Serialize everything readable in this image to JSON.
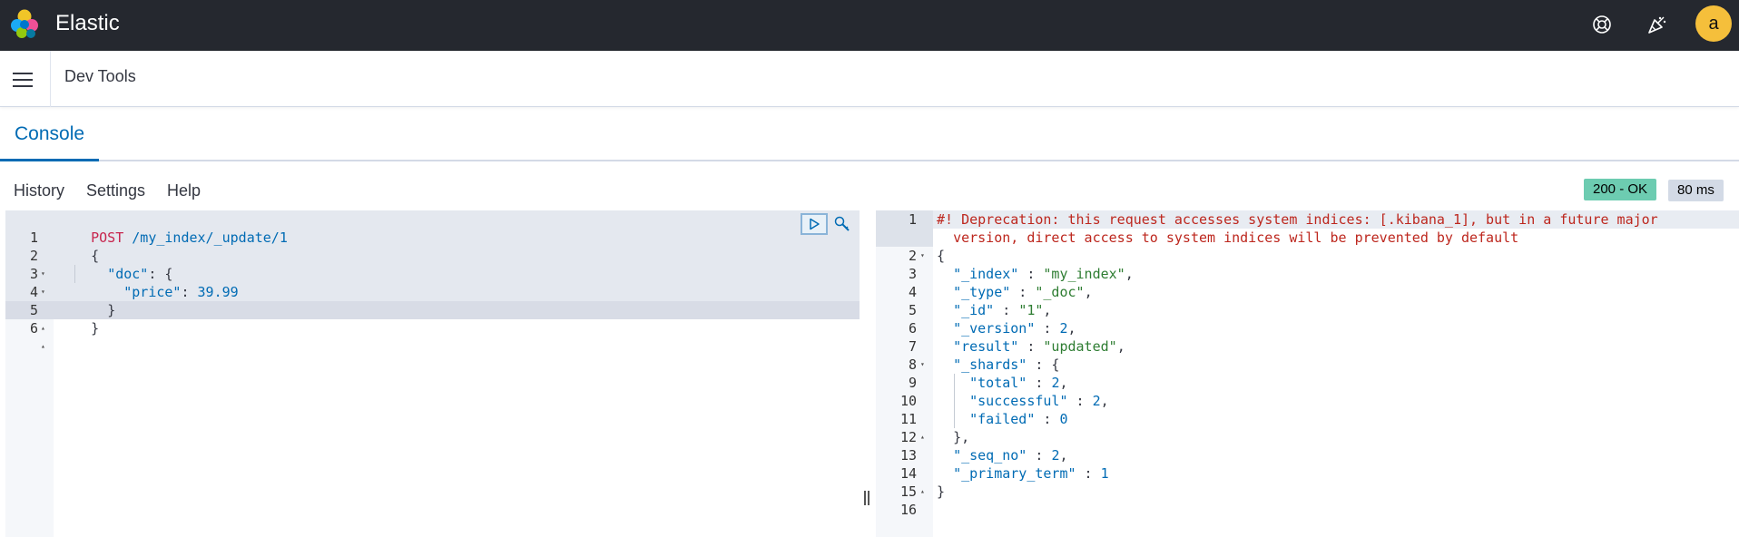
{
  "app": {
    "brand": "Elastic",
    "avatar_initial": "a"
  },
  "header": {
    "title": "Dev Tools",
    "icons": [
      "help-icon",
      "newsfeed-icon"
    ]
  },
  "tabs": [
    {
      "label": "Console",
      "active": true
    }
  ],
  "toolbar": {
    "history": "History",
    "settings": "Settings",
    "help": "Help"
  },
  "status": {
    "code": "200 - OK",
    "time": "80 ms",
    "status_color": "#6dccb1"
  },
  "request": {
    "lines": [
      {
        "n": "1",
        "fold": ""
      },
      {
        "n": "2",
        "fold": "▾"
      },
      {
        "n": "3",
        "fold": "▾"
      },
      {
        "n": "4",
        "fold": ""
      },
      {
        "n": "5",
        "fold": "▴"
      },
      {
        "n": "6",
        "fold": "▴"
      }
    ],
    "method": "POST",
    "path": "/my_index/_update/1",
    "open_brace": "{",
    "doc_key": "\"doc\"",
    "doc_after": ": {",
    "price_key": "\"price\"",
    "price_colon": ": ",
    "price_value": "39.99",
    "inner_close": "}",
    "outer_close": "}"
  },
  "response": {
    "line_numbers": [
      "1",
      "2",
      "3",
      "4",
      "5",
      "6",
      "7",
      "8",
      "9",
      "10",
      "11",
      "12",
      "13",
      "14",
      "15",
      "16"
    ],
    "warning_line1": "#! Deprecation: this request accesses system indices: [.kibana_1], but in a future major",
    "warning_line2": "version, direct access to system indices will be prevented by default",
    "open_brace": "{",
    "index_key": "\"_index\"",
    "index_val": "\"my_index\"",
    "type_key": "\"_type\"",
    "type_val": "\"_doc\"",
    "id_key": "\"_id\"",
    "id_val": "\"1\"",
    "version_key": "\"_version\"",
    "version_val": "2",
    "result_key": "\"result\"",
    "result_val": "\"updated\"",
    "shards_key": "\"_shards\"",
    "total_key": "\"total\"",
    "total_val": "2",
    "successful_key": "\"successful\"",
    "successful_val": "2",
    "failed_key": "\"failed\"",
    "failed_val": "0",
    "shards_close": "},",
    "seq_key": "\"_seq_no\"",
    "seq_val": "2",
    "term_key": "\"_primary_term\"",
    "term_val": "1",
    "close_brace": "}"
  }
}
